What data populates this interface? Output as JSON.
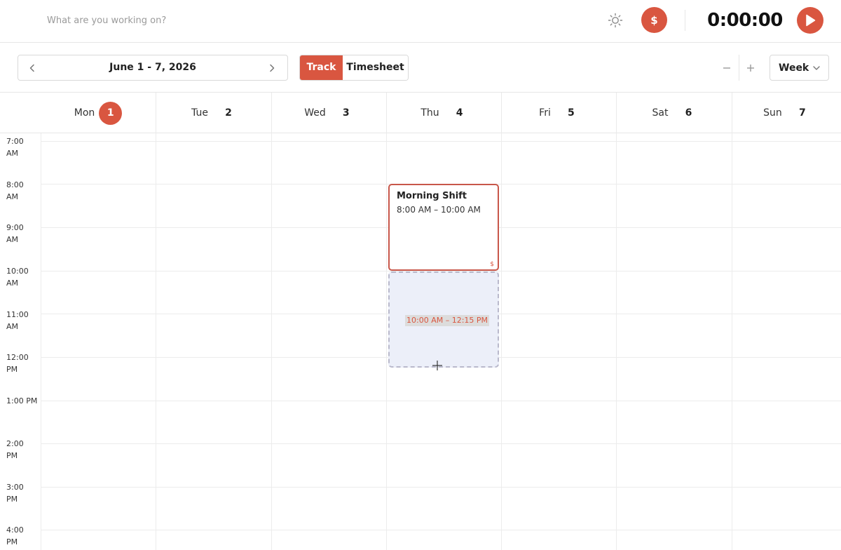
{
  "topbar": {
    "task_placeholder": "What are you working on?",
    "theme_icon": "sun-icon",
    "billable_label": "$",
    "timer": "0:00:00",
    "play_icon": "play-icon"
  },
  "toolbar": {
    "date_range": "June 1 - 7, 2026",
    "modes": [
      "Track",
      "Timesheet"
    ],
    "active_mode": "Track",
    "zoom_out": "minus-icon",
    "zoom_in": "plus-icon",
    "view": "Week"
  },
  "days": [
    {
      "name": "Mon",
      "num": "1",
      "today": true
    },
    {
      "name": "Tue",
      "num": "2",
      "today": false
    },
    {
      "name": "Wed",
      "num": "3",
      "today": false
    },
    {
      "name": "Thu",
      "num": "4",
      "today": false
    },
    {
      "name": "Fri",
      "num": "5",
      "today": false
    },
    {
      "name": "Sat",
      "num": "6",
      "today": false
    },
    {
      "name": "Sun",
      "num": "7",
      "today": false
    }
  ],
  "time_labels": [
    [
      "7:00",
      "AM"
    ],
    [
      "8:00",
      "AM"
    ],
    [
      "9:00",
      "AM"
    ],
    [
      "10:00",
      "AM"
    ],
    [
      "11:00",
      "AM"
    ],
    [
      "12:00",
      "PM"
    ],
    [
      "1:00 PM",
      ""
    ],
    [
      "2:00",
      "PM"
    ],
    [
      "3:00",
      "PM"
    ],
    [
      "4:00",
      "PM"
    ]
  ],
  "event": {
    "title": "Morning Shift",
    "time": "8:00 AM – 10:00 AM",
    "billable": "$"
  },
  "draft": {
    "time": "10:00 AM – 12:15 PM"
  },
  "colors": {
    "accent": "#d95640",
    "draft_bg": "#eceff9"
  }
}
